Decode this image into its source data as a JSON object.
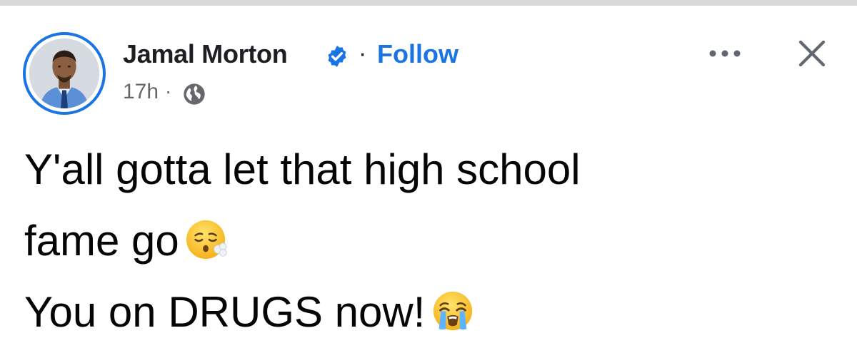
{
  "author": {
    "name": "Jamal Morton",
    "verified": true,
    "follow_label": "Follow",
    "separator": "·"
  },
  "meta": {
    "time": "17h",
    "separator": "·",
    "audience_icon": "globe-icon"
  },
  "post": {
    "line1": "Y'all gotta let that high school",
    "line2": "fame go",
    "line2_emoji": "face-exhaling-emoji",
    "line3": "You on DRUGS now!",
    "line3_emoji": "loudly-crying-face-emoji"
  },
  "icons": {
    "more": "more-options-icon",
    "close": "close-icon",
    "verified": "verified-badge-icon"
  },
  "colors": {
    "accent": "#1b74e4",
    "text": "#050505",
    "secondary": "#65676b"
  }
}
